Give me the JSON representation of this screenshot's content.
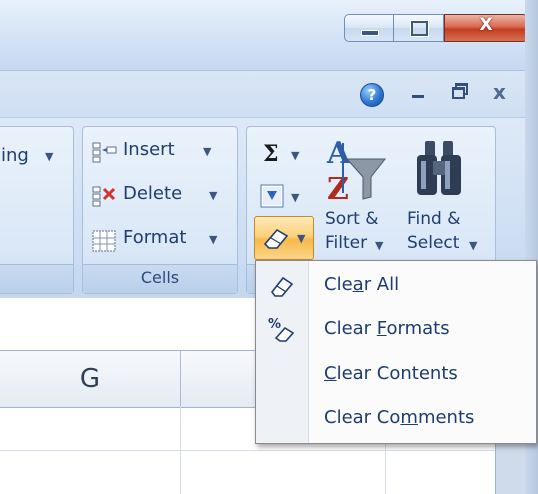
{
  "window": {
    "close_label": "X"
  },
  "doc_controls": {
    "help_glyph": "?",
    "close_glyph": "x"
  },
  "ribbon": {
    "styles_group": {
      "button_fragment": "ing"
    },
    "cells_group": {
      "insert_label": "Insert",
      "delete_label": "Delete",
      "format_label": "Format",
      "group_label": "Cells"
    },
    "editing_group": {
      "sum_glyph": "Σ",
      "sort_filter_line1": "Sort &",
      "sort_filter_line2": "Filter",
      "find_select_line1": "Find &",
      "find_select_line2": "Select"
    }
  },
  "sheet": {
    "column_header": "G"
  },
  "clear_menu": {
    "items": [
      {
        "pre": "Cle",
        "key": "a",
        "post": "r All",
        "icon": "eraser-icon"
      },
      {
        "pre": "Clear ",
        "key": "F",
        "post": "ormats",
        "icon": "clear-formats-icon"
      },
      {
        "pre": "",
        "key": "C",
        "post": "lear Contents",
        "icon": ""
      },
      {
        "pre": "Clear Co",
        "key": "m",
        "post": "ments",
        "icon": ""
      }
    ]
  },
  "colors": {
    "ribbon_text": "#1f3d70",
    "menu_text": "#1c3c72",
    "highlight": "#fbd27a"
  }
}
